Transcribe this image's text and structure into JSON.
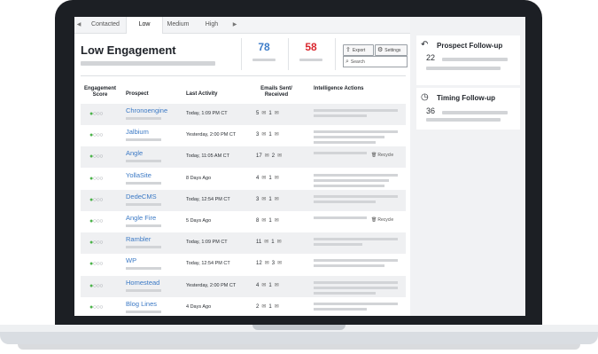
{
  "tabs": [
    {
      "label": "Contacted"
    },
    {
      "label": "Low"
    },
    {
      "label": "Medium"
    },
    {
      "label": "High"
    }
  ],
  "nav": {
    "prev": "◀",
    "next": "▶"
  },
  "header": {
    "title": "Low Engagement",
    "stat1": {
      "value": "78",
      "color": "#3d7cc9"
    },
    "stat2": {
      "value": "58",
      "color": "#d9272e"
    },
    "export_label": "Export",
    "settings_label": "Settings",
    "search_placeholder": "Search"
  },
  "columns": {
    "score": "Engagement Score",
    "prospect": "Prospect",
    "activity": "Last Activity",
    "emails": "Emails Sent/ Received",
    "actions": "Intelligence Actions"
  },
  "rows": [
    {
      "name": "Chronoengine",
      "activity": "Today, 1:09 PM CT",
      "sent": "5",
      "received": "1",
      "recycle": ""
    },
    {
      "name": "Jalbium",
      "activity": "Yesterday, 2:00 PM CT",
      "sent": "3",
      "received": "1",
      "recycle": ""
    },
    {
      "name": "Angle",
      "activity": "Today, 11:05 AM CT",
      "sent": "17",
      "received": "2",
      "recycle": "Recycle"
    },
    {
      "name": "YollaSite",
      "activity": "8 Days Ago",
      "sent": "4",
      "received": "1",
      "recycle": ""
    },
    {
      "name": "DedeCMS",
      "activity": "Today, 12:54 PM CT",
      "sent": "3",
      "received": "1",
      "recycle": ""
    },
    {
      "name": "Angle Fire",
      "activity": "5 Days Ago",
      "sent": "8",
      "received": "1",
      "recycle": "Recycle"
    },
    {
      "name": "Rambler",
      "activity": "Today, 1:09 PM CT",
      "sent": "11",
      "received": "1",
      "recycle": ""
    },
    {
      "name": "WP",
      "activity": "Today, 12:54 PM CT",
      "sent": "12",
      "received": "3",
      "recycle": ""
    },
    {
      "name": "Homestead",
      "activity": "Yesterday, 2:00 PM CT",
      "sent": "4",
      "received": "1",
      "recycle": ""
    },
    {
      "name": "Blog Lines",
      "activity": "4 Days Ago",
      "sent": "2",
      "received": "1",
      "recycle": ""
    }
  ],
  "score_display": "●○○○",
  "icons": {
    "envelope": "✉",
    "export": "⇪",
    "settings": "⚙",
    "search": "⌕",
    "recycle": "🗑",
    "reply": "↶",
    "clock": "◷"
  },
  "sidebar": {
    "prospect_followup": {
      "title": "Prospect Follow-up",
      "count": "22"
    },
    "timing_followup": {
      "title": "Timing Follow-up",
      "count": "36"
    }
  }
}
